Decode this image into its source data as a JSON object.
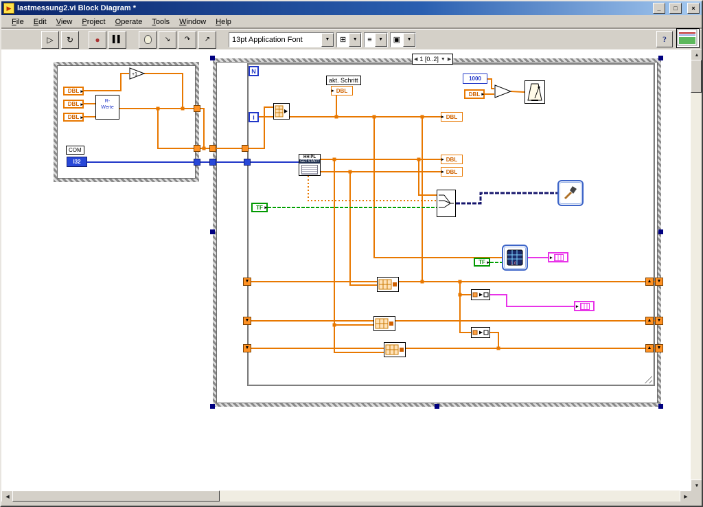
{
  "window": {
    "title": "lastmessung2.vi Block Diagram *",
    "minimize": "_",
    "maximize": "□",
    "close": "×"
  },
  "menu": {
    "items": [
      "File",
      "Edit",
      "View",
      "Project",
      "Operate",
      "Tools",
      "Window",
      "Help"
    ]
  },
  "toolbar": {
    "run": "▷",
    "run_continuous": "↻",
    "abort": "●",
    "pause": "▌▌",
    "step_into": "↘",
    "step_over": "↷",
    "step_out": "↗",
    "font_selector": "13pt Application Font",
    "align_tool": "⊞",
    "distribute_tool": "≡",
    "reorder_tool": "▣",
    "dropdown": "▼",
    "help": "?"
  },
  "diagram": {
    "sequence_selector": {
      "prev": "◀",
      "label": "1 [0..2]",
      "menu": "▼",
      "next": "▶"
    },
    "labels": {
      "dbl": "DBL",
      "i32": "I32",
      "com": "COM",
      "tf": "TF",
      "n": "N",
      "i": "i",
      "akt_schritt": "akt. Schritt",
      "const_1000": "1000",
      "increment": "+1",
      "rwerte_line1": "R-",
      "rwerte_line2": "Werte",
      "hhpl_line1": "HH PL",
      "hhpl_line2": "GET START",
      "chart_version": "1.0",
      "sr_down": "▼",
      "sr_up": "▲"
    },
    "colors": {
      "wire_numeric": "#e87800",
      "wire_integer": "#2036c8",
      "wire_boolean": "#00a000",
      "wire_string": "#e833e8",
      "wire_dynamic": "#16166c"
    }
  },
  "scrollbars": {
    "up": "▲",
    "down": "▼",
    "left": "◀",
    "right": "▶"
  }
}
